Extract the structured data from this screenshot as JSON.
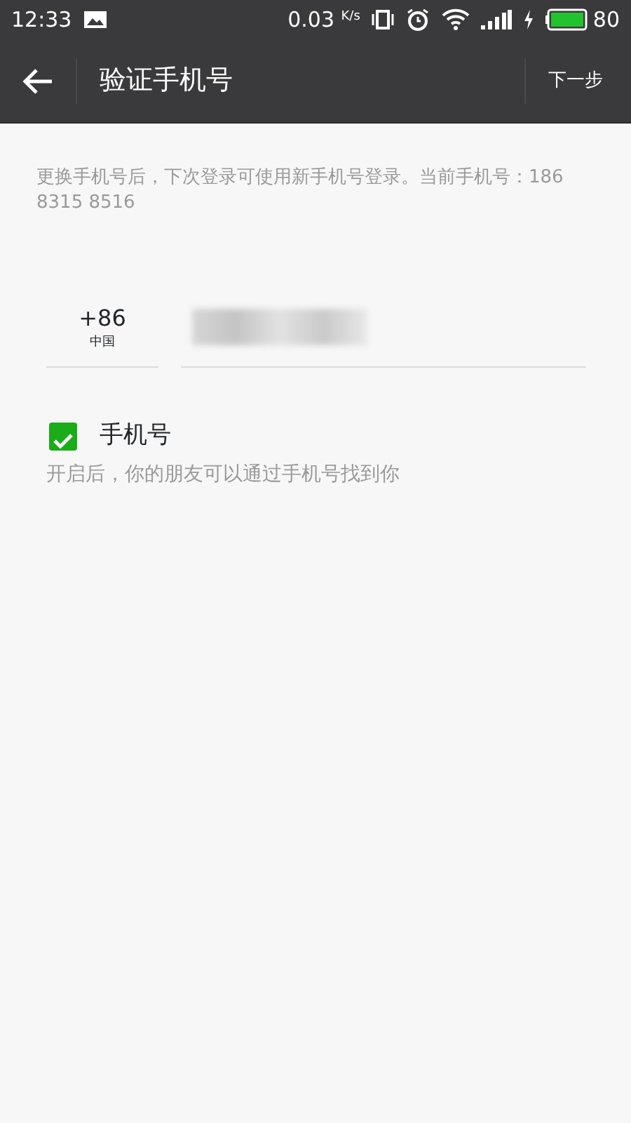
{
  "status_bar": {
    "time": "12:33",
    "speed": "0.03",
    "speed_unit": "K/s",
    "battery": "80"
  },
  "header": {
    "title": "验证手机号",
    "action": "下一步"
  },
  "notice": "更换手机号后，下次登录可使用新手机号登录。当前手机号：186 8315 8516",
  "country": {
    "code": "+86",
    "name": "中国"
  },
  "phone_field": {
    "blurred": true
  },
  "option": {
    "label": "手机号",
    "checked": true,
    "hint": "开启后，你的朋友可以通过手机号找到你"
  }
}
